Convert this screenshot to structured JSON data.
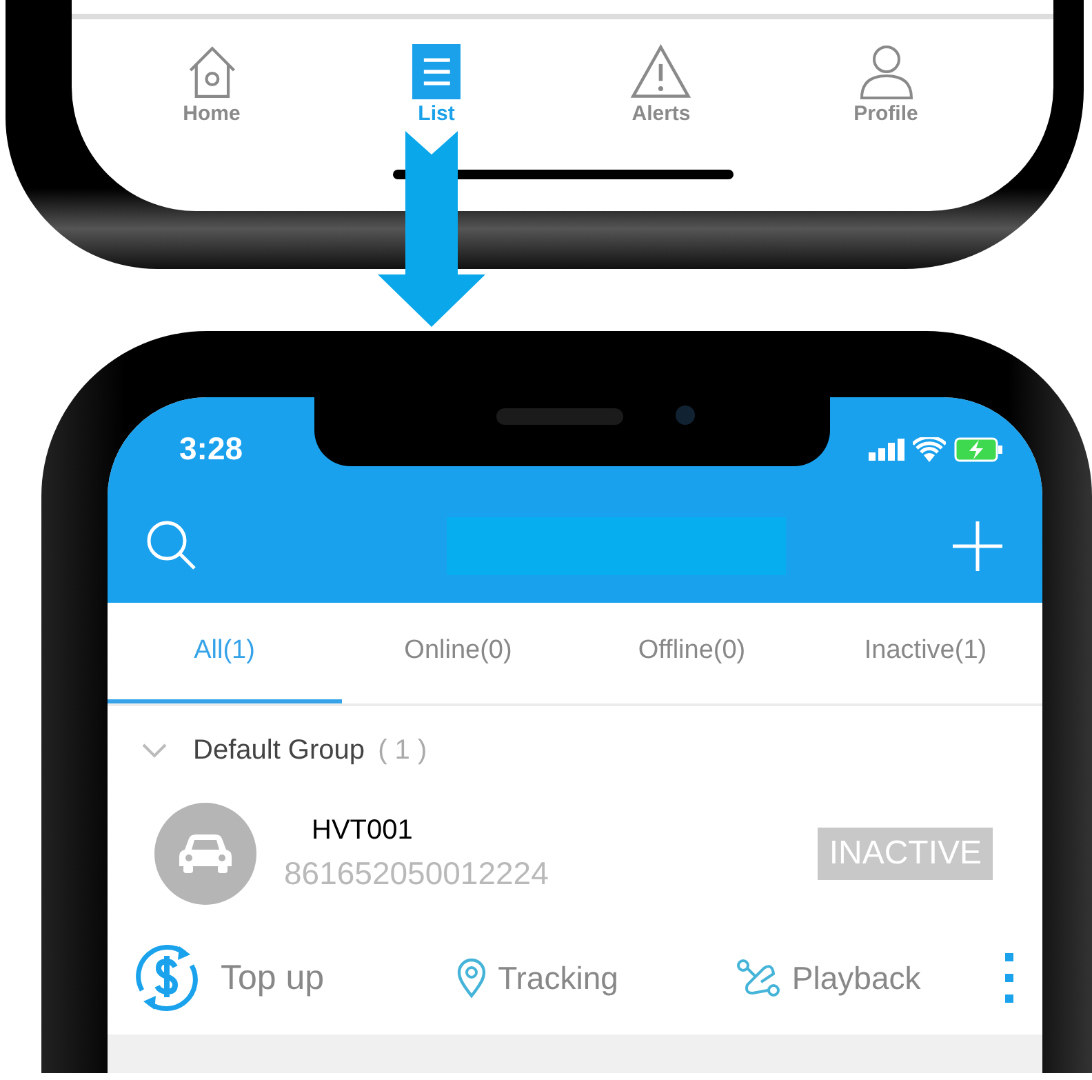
{
  "bottom_nav": [
    {
      "label": "Home",
      "kind": "home",
      "selected": false
    },
    {
      "label": "List",
      "kind": "list",
      "selected": true
    },
    {
      "label": "Alerts",
      "kind": "alerts",
      "selected": false
    },
    {
      "label": "Profile",
      "kind": "profile",
      "selected": false
    }
  ],
  "status_bar": {
    "time": "3:28"
  },
  "tabs": [
    {
      "label": "All(1)",
      "selected": true
    },
    {
      "label": "Online(0)",
      "selected": false
    },
    {
      "label": "Offline(0)",
      "selected": false
    },
    {
      "label": "Inactive(1)",
      "selected": false
    }
  ],
  "group": {
    "name": "Default Group",
    "count": "( 1 )",
    "expanded": true
  },
  "device": {
    "name": "HVT001",
    "imei": "861652050012224",
    "status": "INACTIVE"
  },
  "actions": [
    {
      "label": "Top up",
      "kind": "topup"
    },
    {
      "label": "Tracking",
      "kind": "tracking"
    },
    {
      "label": "Playback",
      "kind": "playback"
    }
  ]
}
